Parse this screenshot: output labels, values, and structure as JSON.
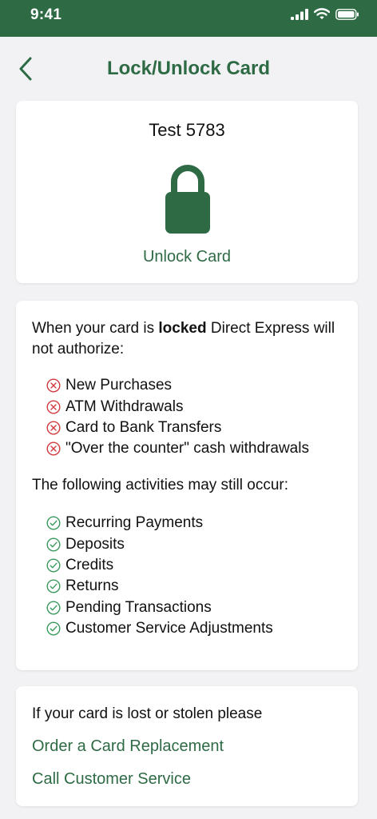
{
  "status_bar": {
    "time": "9:41"
  },
  "header": {
    "title": "Lock/Unlock Card"
  },
  "card_status": {
    "card_name": "Test 5783",
    "lock_state_icon": "lock-icon",
    "action_label": "Unlock Card"
  },
  "info": {
    "locked_intro_prefix": "When your card is ",
    "locked_intro_bold": "locked",
    "locked_intro_suffix": " Direct Express will not authorize:",
    "blocked_items": [
      "New Purchases",
      "ATM Withdrawals",
      "Card to Bank Transfers",
      "\"Over the counter\" cash withdrawals"
    ],
    "allowed_intro": "The following activities may still occur:",
    "allowed_items": [
      "Recurring Payments",
      "Deposits",
      "Credits",
      "Returns",
      "Pending Transactions",
      "Customer Service Adjustments"
    ]
  },
  "lost_card": {
    "text": "If your card is lost or stolen please",
    "replacement_link": "Order a Card Replacement",
    "service_link": "Call Customer Service"
  },
  "colors": {
    "brand_green": "#2e6b45",
    "error_red": "#d0393d",
    "success_green": "#3a9a5e",
    "background": "#f2f2f4"
  }
}
